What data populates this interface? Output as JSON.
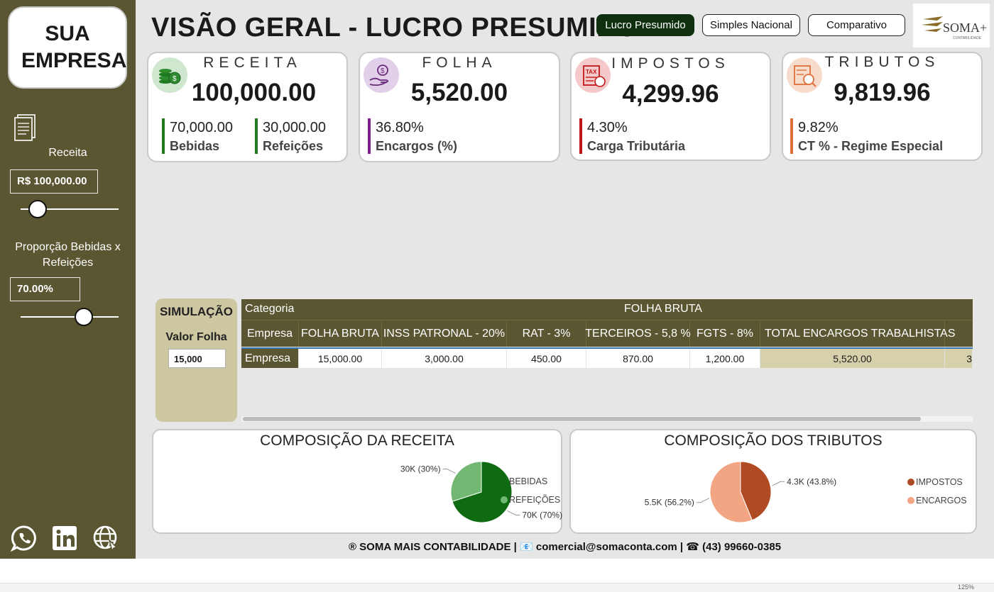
{
  "sidebar": {
    "company": "SUA EMPRESA",
    "receita_label": "Receita",
    "receita_value": "R$ 100,000.00",
    "receita_slider_fraction": 0.1,
    "proporcao_label": "Proporção Bebidas x Refeições",
    "proporcao_value": "70.00%",
    "proporcao_slider_fraction": 0.7,
    "icons": [
      "document-icon",
      "whatsapp-icon",
      "linkedin-icon",
      "web-globe-icon"
    ]
  },
  "header": {
    "title": "VISÃO GERAL - LUCRO PRESUMIDO",
    "tabs": [
      {
        "label": "Lucro Presumido",
        "active": true
      },
      {
        "label": "Simples Nacional",
        "active": false
      },
      {
        "label": "Comparativo",
        "active": false
      }
    ],
    "brand_text": "SOMA+",
    "brand_subtext": "CONTABILIDADE"
  },
  "kpis": [
    {
      "label": "RECEITA",
      "value": "100,000.00",
      "icon": "money-coins-icon",
      "icon_bg": "#cfe6cf",
      "subs": [
        {
          "value": "70,000.00",
          "label": "Bebidas",
          "color": "#1f7a1f"
        },
        {
          "value": "30,000.00",
          "label": "Refeições",
          "color": "#1f7a1f"
        }
      ]
    },
    {
      "label": "FOLHA",
      "value": "5,520.00",
      "icon": "money-hand-icon",
      "icon_bg": "#e2cfe9",
      "subs": [
        {
          "value": "36.80%",
          "label": "Encargos (%)",
          "color": "#7a1f8a"
        }
      ]
    },
    {
      "label": "IMPOSTOS",
      "value": "4,299.96",
      "icon": "tax-document-icon",
      "icon_bg": "#f5c9c9",
      "subs": [
        {
          "value": "4.30%",
          "label": "Carga Tributária",
          "color": "#c01818"
        }
      ]
    },
    {
      "label": "TRIBUTOS",
      "value": "9,819.96",
      "icon": "tax-calculator-icon",
      "icon_bg": "#f8dccb",
      "subs": [
        {
          "value": "9.82%",
          "label": "CT % - Regime Especial",
          "color": "#e0703a"
        }
      ]
    }
  ],
  "simulacao": {
    "title": "SIMULAÇÃO",
    "valor_folha_label": "Valor Folha",
    "valor_folha": "15,000"
  },
  "table": {
    "categoria_label": "Categoria",
    "group_label": "FOLHA BRUTA",
    "headers": [
      "Empresa",
      "FOLHA BRUTA",
      "INSS PATRONAL - 20%",
      "RAT - 3%",
      "TERCEIROS - 5,8 %",
      "FGTS - 8%",
      "TOTAL ENCARGOS TRABALHISTAS"
    ],
    "rows": [
      [
        "Empresa",
        "15,000.00",
        "3,000.00",
        "450.00",
        "870.00",
        "1,200.00",
        "5,520.00"
      ]
    ],
    "overflow_fragment": "3"
  },
  "chart_data": [
    {
      "type": "pie",
      "title": "COMPOSIÇÃO DA RECEITA",
      "categories": [
        "BEBIDAS",
        "REFEIÇÕES"
      ],
      "values": [
        70000,
        30000
      ],
      "data_labels": [
        "70K (70%)",
        "30K (30%)"
      ],
      "colors": [
        "#0e6b12",
        "#72b872"
      ],
      "legend": "right"
    },
    {
      "type": "pie",
      "title": "COMPOSIÇÃO DOS TRIBUTOS",
      "categories": [
        "IMPOSTOS",
        "ENCARGOS"
      ],
      "values": [
        4299.96,
        5520
      ],
      "data_labels": [
        "4.3K (43.8%)",
        "5.5K (56.2%)"
      ],
      "colors": [
        "#b04a22",
        "#f1a582"
      ],
      "legend": "right"
    }
  ],
  "footer": "® SOMA MAIS CONTABILIDADE | 📧 comercial@somaconta.com | ☎ (43) 99660-0385",
  "statusbar": {
    "zoom": "125%"
  }
}
